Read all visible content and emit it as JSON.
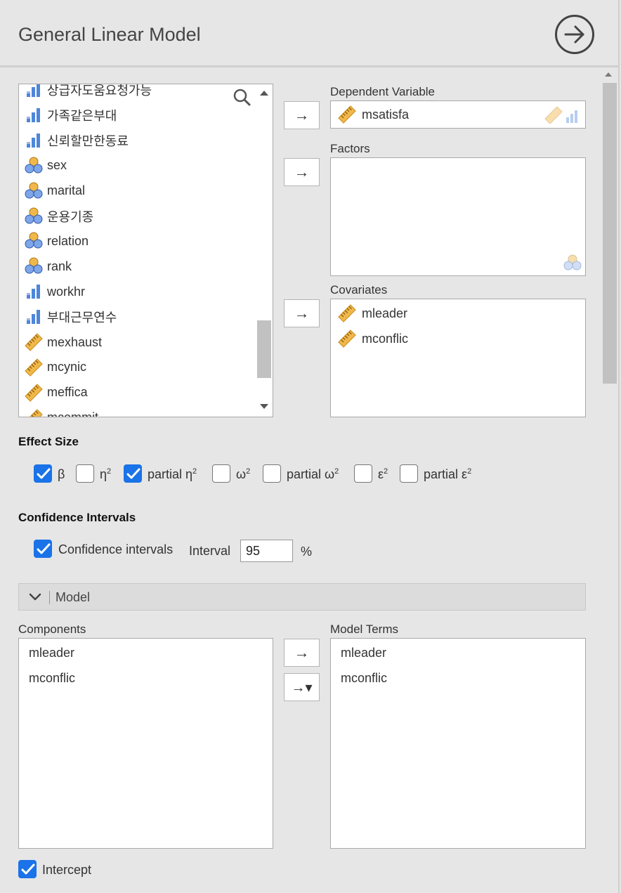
{
  "header": {
    "title": "General Linear Model",
    "go_icon": "arrow-circle-right-icon"
  },
  "variables": [
    {
      "name": "상급자도움요청가능",
      "type": "ordinal"
    },
    {
      "name": "가족같은부대",
      "type": "ordinal"
    },
    {
      "name": "신뢰할만한동료",
      "type": "ordinal"
    },
    {
      "name": "sex",
      "type": "nominal"
    },
    {
      "name": "marital",
      "type": "nominal"
    },
    {
      "name": "운용기종",
      "type": "nominal"
    },
    {
      "name": "relation",
      "type": "nominal"
    },
    {
      "name": "rank",
      "type": "nominal"
    },
    {
      "name": "workhr",
      "type": "ordinal"
    },
    {
      "name": "부대근무연수",
      "type": "ordinal"
    },
    {
      "name": "mexhaust",
      "type": "continuous"
    },
    {
      "name": "mcynic",
      "type": "continuous"
    },
    {
      "name": "meffica",
      "type": "continuous"
    },
    {
      "name": "mcommit",
      "type": "continuous"
    }
  ],
  "targets": {
    "dependent": {
      "label": "Dependent Variable",
      "value": "msatisfa"
    },
    "factors": {
      "label": "Factors",
      "items": []
    },
    "covariates": {
      "label": "Covariates",
      "items": [
        "mleader",
        "mconflic"
      ]
    }
  },
  "move_button": "→",
  "effect_size": {
    "title": "Effect Size",
    "options": [
      {
        "label": "β",
        "sup": "",
        "checked": true
      },
      {
        "label": "η",
        "sup": "2",
        "checked": false
      },
      {
        "label": "partial η",
        "sup": "2",
        "checked": true
      },
      {
        "label": "ω",
        "sup": "2",
        "checked": false
      },
      {
        "label": "partial ω",
        "sup": "2",
        "checked": false
      },
      {
        "label": "ε",
        "sup": "2",
        "checked": false
      },
      {
        "label": "partial ε",
        "sup": "2",
        "checked": false
      }
    ]
  },
  "confidence": {
    "title": "Confidence Intervals",
    "checkbox_label": "Confidence intervals",
    "checked": true,
    "interval_label": "Interval",
    "interval_value": "95",
    "unit": "%"
  },
  "model": {
    "section_label": "Model",
    "components_label": "Components",
    "components": [
      "mleader",
      "mconflic"
    ],
    "terms_label": "Model Terms",
    "terms": [
      "mleader",
      "mconflic"
    ],
    "interaction_button": "→▾"
  },
  "intercept": {
    "label": "Intercept",
    "checked": true
  },
  "colors": {
    "accent": "#1a73e8",
    "continuous": "#f0b84a",
    "ordinal": "#4e86d9"
  }
}
